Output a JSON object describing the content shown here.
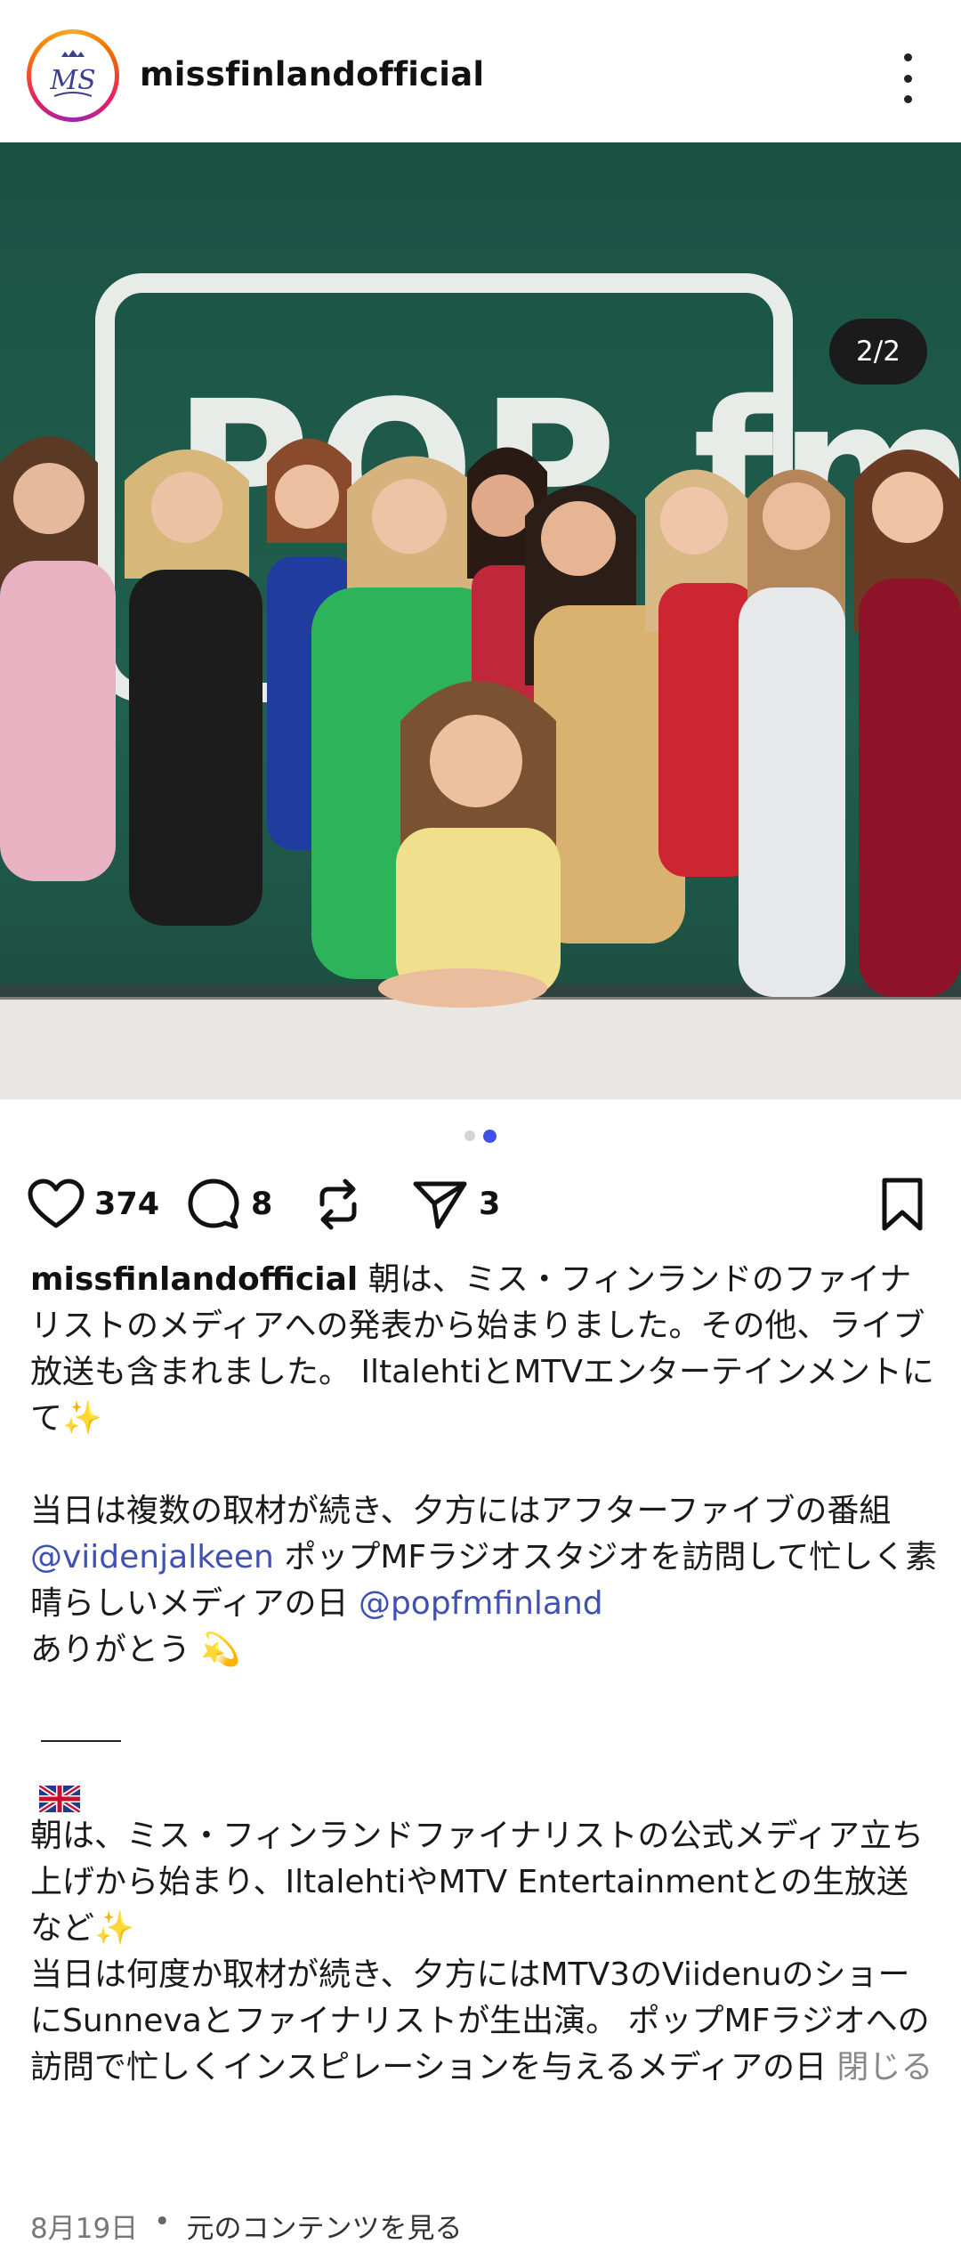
{
  "post": {
    "username": "missfinlandofficial",
    "photo_counter": "2/2",
    "carousel": {
      "total": 2,
      "active": 2
    },
    "photo_sign_text": "POP fm",
    "photo_colors": {
      "wall": "#1f5a4a"
    }
  },
  "actions": {
    "likes": "374",
    "comments": "8",
    "shares": "3"
  },
  "caption": {
    "username": "missfinlandofficial",
    "p1_text": " 朝は、ミス・フィンランドのファイナリストのメディアへの発表から始まりました。その他、ライブ放送も含まれました。 IltalehtiとMTVエンターテインメントにて✨",
    "p2_part1": "当日は複数の取材が続き、夕方にはアフターファイブの番組 ",
    "p2_mention1": "@viidenjalkeen",
    "p2_part2": " ポップMFラジオスタジオを訪問して忙しく素晴らしいメディアの日 ",
    "p2_mention2": "@popfmfinland",
    "p2_part3": "ありがとう 💫",
    "flag_label": "🇬🇧",
    "p3_text": "朝は、ミス・フィンランドファイナリストの公式メディア立ち上げから始まり、IltalehtiやMTV Entertainmentとの生放送など✨",
    "p4_text": "当日は何度か取材が続き、夕方にはMTV3のViidenuのショーにSunnevaとファイナリストが生出演。 ポップMFラジオへの訪問で忙しくインスピレーションを与えるメディアの日 ",
    "close_label": "閉じる"
  },
  "footer": {
    "date": "8月19日",
    "separator": "•",
    "view_original": "元のコンテンツを見る"
  },
  "colors": {
    "mention": "#3f51b5",
    "active_dot": "#3f51e6"
  }
}
